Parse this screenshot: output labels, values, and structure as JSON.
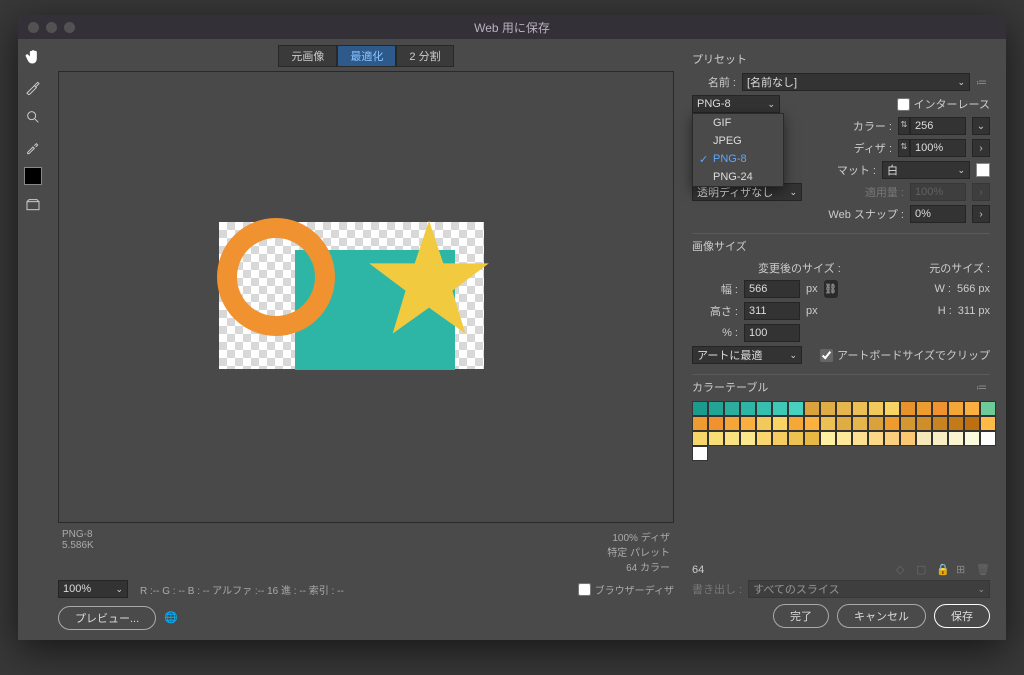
{
  "title": "Web 用に保存",
  "tabs": {
    "original": "元画像",
    "optimized": "最適化",
    "split2": "2 分割"
  },
  "status_left": {
    "format": "PNG-8",
    "size": "5.586K"
  },
  "status_right": {
    "line1": "100% ディザ",
    "line2": "特定 パレット",
    "line3": "64 カラー"
  },
  "zoom": "100%",
  "info_line": "R :-- G : -- B : -- アルファ :-- 16 進 : -- 索引 : --",
  "browser_dither_label": "ブラウザーディザ",
  "preview_btn": "プレビュー...",
  "done_btn": "完了",
  "cancel_btn": "キャンセル",
  "save_btn": "保存",
  "preset": {
    "title": "プリセット",
    "name_label": "名前 :",
    "name_value": "[名前なし]",
    "format_value": "PNG-8",
    "format_options": [
      "GIF",
      "JPEG",
      "PNG-8",
      "PNG-24"
    ],
    "interlace_label": "インターレース",
    "color_label": "カラー :",
    "color_value": "256",
    "dither_label": "ディザ :",
    "dither_value": "100%",
    "matte_label": "マット :",
    "matte_value": "白",
    "transp_dither": "透明ディザなし",
    "apply_label": "適用量 :",
    "apply_value": "100%",
    "websnap_label": "Web スナップ :",
    "websnap_value": "0%"
  },
  "image_size": {
    "title": "画像サイズ",
    "after_label": "変更後のサイズ :",
    "orig_label": "元のサイズ :",
    "w_label": "幅 :",
    "w": "566",
    "unit_px": "px",
    "h_label": "高さ :",
    "h": "311",
    "pct_label": "% :",
    "pct": "100",
    "orig_w_label": "W :",
    "orig_w": "566 px",
    "orig_h_label": "H :",
    "orig_h": "311 px",
    "fit_label": "アートに最適",
    "clip_label": "アートボードサイズでクリップ"
  },
  "color_table": {
    "title": "カラーテーブル",
    "count": "64",
    "export_label": "書き出し :",
    "export_value": "すべてのスライス",
    "swatches": [
      "#1a9b8e",
      "#23a596",
      "#2cae9e",
      "#2db6a6",
      "#36bfae",
      "#3fc8b6",
      "#48d1be",
      "#daa23c",
      "#e0ac44",
      "#e6b64c",
      "#ecc054",
      "#f2ca5c",
      "#f8d464",
      "#e8922c",
      "#ee9c30",
      "#f09230",
      "#f4a638",
      "#fab040",
      "#6dcb98",
      "#ee9c30",
      "#f09230",
      "#f4a638",
      "#fab040",
      "#f2ca5c",
      "#f8d464",
      "#f6a836",
      "#fcb23e",
      "#ecc054",
      "#e0ac44",
      "#e6b64c",
      "#daa23c",
      "#ee9c30",
      "#d49832",
      "#ce8e2a",
      "#c88422",
      "#c27a1a",
      "#bc7012",
      "#ffba48",
      "#f6d668",
      "#f8dc74",
      "#fae280",
      "#fce88c",
      "#fad66e",
      "#f4cc60",
      "#eec252",
      "#e8b844",
      "#fef0a0",
      "#fee89a",
      "#fde090",
      "#fcd886",
      "#fbd07c",
      "#fac872",
      "#f6e8b8",
      "#f8eec4",
      "#faf4d0",
      "#fcfadc",
      "#ffffff",
      "#fefefe"
    ]
  }
}
